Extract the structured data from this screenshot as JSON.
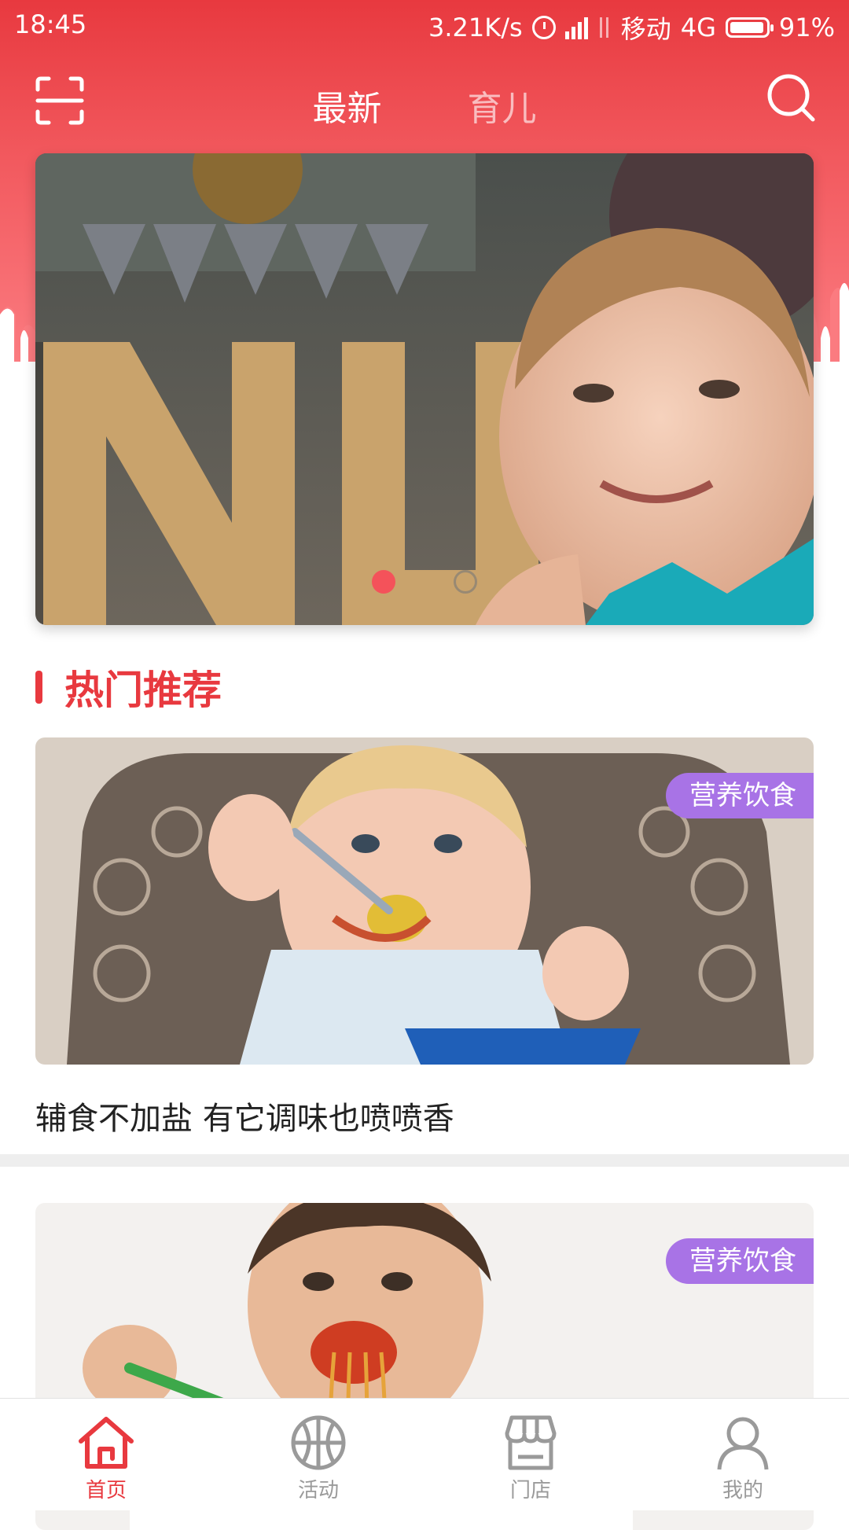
{
  "status_bar": {
    "time": "18:45",
    "speed": "3.21K/s",
    "carrier": "移动",
    "network": "4G",
    "battery": "91%",
    "icons": [
      "alarm-clock-icon",
      "hd-signal-icon",
      "data-arrows-icon",
      "battery-icon"
    ]
  },
  "header": {
    "tabs": [
      {
        "label": "最新",
        "active": true
      },
      {
        "label": "育儿",
        "active": false
      }
    ],
    "left_icon": "scan-icon",
    "right_icon": "search-icon"
  },
  "banner": {
    "slides": 2,
    "active_slide": 1
  },
  "section": {
    "title": "热门推荐"
  },
  "articles": [
    {
      "tag": "营养饮食",
      "title": "辅食不加盐 有它调味也喷喷香"
    },
    {
      "tag": "营养饮食",
      "title": ""
    }
  ],
  "bottom_nav": [
    {
      "label": "首页",
      "icon": "home-icon",
      "active": true
    },
    {
      "label": "活动",
      "icon": "basketball-icon",
      "active": false
    },
    {
      "label": "门店",
      "icon": "store-icon",
      "active": false
    },
    {
      "label": "我的",
      "icon": "user-icon",
      "active": false
    }
  ],
  "colors": {
    "brand_red": "#e8393f",
    "tag_purple": "#a873e6",
    "inactive_gray": "#9a9a9a"
  }
}
